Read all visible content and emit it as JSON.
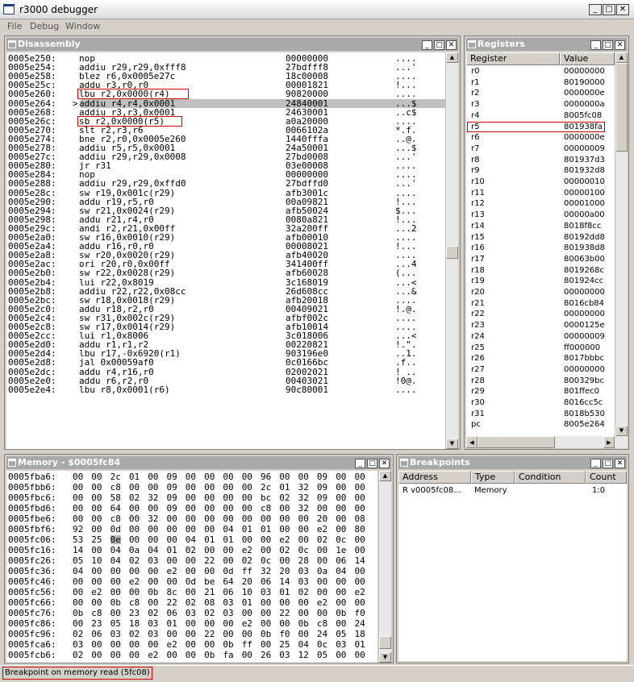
{
  "app": {
    "title": "r3000 debugger",
    "menus": [
      "File",
      "Debug",
      "Window"
    ]
  },
  "panels": {
    "disassembly": "Disassembly",
    "registers": "Registers",
    "memory": "Memory - $0005fc84",
    "breakpoints": "Breakpoints"
  },
  "disasm": [
    {
      "addr": "0005e250:",
      "cur": " ",
      "instr": "nop",
      "hex": "00000000",
      "ascii": "...."
    },
    {
      "addr": "0005e254:",
      "cur": " ",
      "instr": "addiu r29,r29,0xfff8",
      "hex": "27bdfff8",
      "ascii": "...'"
    },
    {
      "addr": "0005e258:",
      "cur": " ",
      "instr": "blez r6,0x0005e27c",
      "hex": "18c00008",
      "ascii": "...."
    },
    {
      "addr": "0005e25c:",
      "cur": " ",
      "instr": "addu r3,r0,r0",
      "hex": "00001821",
      "ascii": "!..."
    },
    {
      "addr": "0005e260:",
      "cur": " ",
      "instr": "lbu r2,0x0000(r4)",
      "hex": "90820000",
      "ascii": "...."
    },
    {
      "addr": "0005e264:",
      "cur": ">",
      "instr": "addiu r4,r4,0x0001",
      "hex": "24840001",
      "ascii": "...$"
    },
    {
      "addr": "0005e268:",
      "cur": " ",
      "instr": "addiu r3,r3,0x0001",
      "hex": "24630001",
      "ascii": "..c$"
    },
    {
      "addr": "0005e26c:",
      "cur": " ",
      "instr": "sb r2,0x0000(r5)",
      "hex": "a0a20000",
      "ascii": "...."
    },
    {
      "addr": "0005e270:",
      "cur": " ",
      "instr": "slt r2,r3,r6",
      "hex": "0066102a",
      "ascii": "*.f."
    },
    {
      "addr": "0005e274:",
      "cur": " ",
      "instr": "bne r2,r0,0x0005e260",
      "hex": "1440fffa",
      "ascii": "..@."
    },
    {
      "addr": "0005e278:",
      "cur": " ",
      "instr": "addiu r5,r5,0x0001",
      "hex": "24a50001",
      "ascii": "...$"
    },
    {
      "addr": "0005e27c:",
      "cur": " ",
      "instr": "addiu r29,r29,0x0008",
      "hex": "27bd0008",
      "ascii": "...'"
    },
    {
      "addr": "0005e280:",
      "cur": " ",
      "instr": "jr r31",
      "hex": "03e00008",
      "ascii": "...."
    },
    {
      "addr": "0005e284:",
      "cur": " ",
      "instr": "nop",
      "hex": "00000000",
      "ascii": "...."
    },
    {
      "addr": "0005e288:",
      "cur": " ",
      "instr": "addiu r29,r29,0xffd0",
      "hex": "27bdffd0",
      "ascii": "...'"
    },
    {
      "addr": "0005e28c:",
      "cur": " ",
      "instr": "sw r19,0x001c(r29)",
      "hex": "afb3001c",
      "ascii": "...."
    },
    {
      "addr": "0005e290:",
      "cur": " ",
      "instr": "addu r19,r5,r0",
      "hex": "00a09821",
      "ascii": "!..."
    },
    {
      "addr": "0005e294:",
      "cur": " ",
      "instr": "sw r21,0x0024(r29)",
      "hex": "afb50024",
      "ascii": "$..."
    },
    {
      "addr": "0005e298:",
      "cur": " ",
      "instr": "addu r21,r4,r0",
      "hex": "0080a821",
      "ascii": "!..."
    },
    {
      "addr": "0005e29c:",
      "cur": " ",
      "instr": "andi r2,r21,0x00ff",
      "hex": "32a200ff",
      "ascii": "...2"
    },
    {
      "addr": "0005e2a0:",
      "cur": " ",
      "instr": "sw r16,0x0010(r29)",
      "hex": "afb00010",
      "ascii": "...."
    },
    {
      "addr": "0005e2a4:",
      "cur": " ",
      "instr": "addu r16,r0,r0",
      "hex": "00008021",
      "ascii": "!..."
    },
    {
      "addr": "0005e2a8:",
      "cur": " ",
      "instr": "sw r20,0x0020(r29)",
      "hex": "afb40020",
      "ascii": "...."
    },
    {
      "addr": "0005e2ac:",
      "cur": " ",
      "instr": "ori r20,r0,0x00ff",
      "hex": "341400ff",
      "ascii": "...4"
    },
    {
      "addr": "0005e2b0:",
      "cur": " ",
      "instr": "sw r22,0x0028(r29)",
      "hex": "afb60028",
      "ascii": "(..."
    },
    {
      "addr": "0005e2b4:",
      "cur": " ",
      "instr": "lui r22,0x8019",
      "hex": "3c168019",
      "ascii": "...<"
    },
    {
      "addr": "0005e2b8:",
      "cur": " ",
      "instr": "addiu r22,r22,0x08cc",
      "hex": "26d608cc",
      "ascii": "...&"
    },
    {
      "addr": "0005e2bc:",
      "cur": " ",
      "instr": "sw r18,0x0018(r29)",
      "hex": "afb20018",
      "ascii": "...."
    },
    {
      "addr": "0005e2c0:",
      "cur": " ",
      "instr": "addu r18,r2,r0",
      "hex": "00409021",
      "ascii": "!.@."
    },
    {
      "addr": "0005e2c4:",
      "cur": " ",
      "instr": "sw r31,0x002c(r29)",
      "hex": "afbf002c",
      "ascii": "...."
    },
    {
      "addr": "0005e2c8:",
      "cur": " ",
      "instr": "sw r17,0x0014(r29)",
      "hex": "afb10014",
      "ascii": "...."
    },
    {
      "addr": "0005e2cc:",
      "cur": " ",
      "instr": "lui r1,0x8006",
      "hex": "3c018006",
      "ascii": "...<"
    },
    {
      "addr": "0005e2d0:",
      "cur": " ",
      "instr": "addu r1,r1,r2",
      "hex": "00220821",
      "ascii": "!.\"."
    },
    {
      "addr": "0005e2d4:",
      "cur": " ",
      "instr": "lbu r17,-0x6920(r1)",
      "hex": "903196e0",
      "ascii": "..1."
    },
    {
      "addr": "0005e2d8:",
      "cur": " ",
      "instr": "jal 0x00059af0",
      "hex": "0c0166bc",
      "ascii": ".f.."
    },
    {
      "addr": "0005e2dc:",
      "cur": " ",
      "instr": "addu r4,r16,r0",
      "hex": "02002021",
      "ascii": "! .."
    },
    {
      "addr": "0005e2e0:",
      "cur": " ",
      "instr": "addu r6,r2,r0",
      "hex": "00403021",
      "ascii": "!0@."
    },
    {
      "addr": "0005e2e4:",
      "cur": " ",
      "instr": "lbu r8,0x0001(r6)",
      "hex": "90c80001",
      "ascii": "...."
    }
  ],
  "registers": {
    "col_register": "Register",
    "col_value": "Value",
    "rows": [
      [
        "r0",
        "00000000"
      ],
      [
        "r1",
        "80190000"
      ],
      [
        "r2",
        "0000000e"
      ],
      [
        "r3",
        "0000000a"
      ],
      [
        "r4",
        "8005fc08"
      ],
      [
        "r5",
        "801938fa"
      ],
      [
        "r6",
        "0000000e"
      ],
      [
        "r7",
        "00000009"
      ],
      [
        "r8",
        "801937d3"
      ],
      [
        "r9",
        "801932d8"
      ],
      [
        "r10",
        "00000010"
      ],
      [
        "r11",
        "00000100"
      ],
      [
        "r12",
        "00001000"
      ],
      [
        "r13",
        "00000a00"
      ],
      [
        "r14",
        "8018f8cc"
      ],
      [
        "r15",
        "80192dd8"
      ],
      [
        "r16",
        "801938d8"
      ],
      [
        "r17",
        "80063b00"
      ],
      [
        "r18",
        "8019268c"
      ],
      [
        "r19",
        "801924cc"
      ],
      [
        "r20",
        "00000000"
      ],
      [
        "r21",
        "8016cb84"
      ],
      [
        "r22",
        "00000000"
      ],
      [
        "r23",
        "0000125e"
      ],
      [
        "r24",
        "00000009"
      ],
      [
        "r25",
        "ff000000"
      ],
      [
        "r26",
        "8017bbbc"
      ],
      [
        "r27",
        "00000000"
      ],
      [
        "r28",
        "800329bc"
      ],
      [
        "r29",
        "801ffec0"
      ],
      [
        "r30",
        "8016cc5c"
      ],
      [
        "r31",
        "8018b530"
      ],
      [
        "pc",
        "8005e264"
      ]
    ]
  },
  "memory": [
    {
      "addr": "0005fba6:",
      "bytes": [
        "00",
        "00",
        "2c",
        "01",
        "00",
        "09",
        "00",
        "00",
        "00",
        "00",
        "96",
        "00",
        "00",
        "09",
        "00",
        "00"
      ]
    },
    {
      "addr": "0005fbb6:",
      "bytes": [
        "00",
        "00",
        "c8",
        "00",
        "00",
        "09",
        "00",
        "00",
        "00",
        "00",
        "2c",
        "01",
        "32",
        "09",
        "00",
        "00"
      ]
    },
    {
      "addr": "0005fbc6:",
      "bytes": [
        "00",
        "00",
        "58",
        "02",
        "32",
        "09",
        "00",
        "00",
        "00",
        "00",
        "bc",
        "02",
        "32",
        "09",
        "00",
        "00"
      ]
    },
    {
      "addr": "0005fbd6:",
      "bytes": [
        "00",
        "00",
        "64",
        "00",
        "00",
        "09",
        "00",
        "00",
        "00",
        "00",
        "c8",
        "00",
        "32",
        "00",
        "00",
        "00"
      ]
    },
    {
      "addr": "0005fbe6:",
      "bytes": [
        "00",
        "00",
        "c8",
        "00",
        "32",
        "00",
        "00",
        "00",
        "00",
        "00",
        "00",
        "00",
        "00",
        "20",
        "00",
        "08"
      ]
    },
    {
      "addr": "0005fbf6:",
      "bytes": [
        "92",
        "00",
        "0d",
        "00",
        "00",
        "00",
        "00",
        "00",
        "04",
        "01",
        "01",
        "00",
        "00",
        "e2",
        "00",
        "80"
      ]
    },
    {
      "addr": "0005fc06:",
      "bytes": [
        "53",
        "25",
        "0e",
        "00",
        "00",
        "00",
        "04",
        "01",
        "01",
        "00",
        "00",
        "e2",
        "00",
        "02",
        "0c",
        "00"
      ]
    },
    {
      "addr": "0005fc16:",
      "bytes": [
        "14",
        "00",
        "04",
        "0a",
        "04",
        "01",
        "02",
        "00",
        "00",
        "e2",
        "00",
        "02",
        "0c",
        "00",
        "1e",
        "00"
      ]
    },
    {
      "addr": "0005fc26:",
      "bytes": [
        "05",
        "10",
        "04",
        "02",
        "03",
        "00",
        "00",
        "22",
        "00",
        "02",
        "0c",
        "00",
        "28",
        "00",
        "06",
        "14"
      ]
    },
    {
      "addr": "0005fc36:",
      "bytes": [
        "04",
        "00",
        "00",
        "00",
        "00",
        "e2",
        "00",
        "00",
        "0d",
        "ff",
        "32",
        "20",
        "03",
        "0a",
        "04",
        "00"
      ]
    },
    {
      "addr": "0005fc46:",
      "bytes": [
        "00",
        "00",
        "00",
        "e2",
        "00",
        "00",
        "0d",
        "be",
        "64",
        "20",
        "06",
        "14",
        "03",
        "00",
        "00",
        "00"
      ]
    },
    {
      "addr": "0005fc56:",
      "bytes": [
        "00",
        "e2",
        "00",
        "00",
        "0b",
        "8c",
        "00",
        "21",
        "06",
        "10",
        "03",
        "01",
        "02",
        "00",
        "00",
        "e2"
      ]
    },
    {
      "addr": "0005fc66:",
      "bytes": [
        "00",
        "00",
        "0b",
        "c8",
        "00",
        "22",
        "02",
        "08",
        "03",
        "01",
        "00",
        "00",
        "00",
        "e2",
        "00",
        "00"
      ]
    },
    {
      "addr": "0005fc76:",
      "bytes": [
        "0b",
        "c8",
        "00",
        "23",
        "02",
        "06",
        "03",
        "02",
        "03",
        "00",
        "00",
        "22",
        "00",
        "00",
        "0b",
        "f0"
      ]
    },
    {
      "addr": "0005fc86:",
      "bytes": [
        "00",
        "23",
        "05",
        "18",
        "03",
        "01",
        "00",
        "00",
        "00",
        "e2",
        "00",
        "00",
        "0b",
        "c8",
        "00",
        "24"
      ]
    },
    {
      "addr": "0005fc96:",
      "bytes": [
        "02",
        "06",
        "03",
        "02",
        "03",
        "00",
        "00",
        "22",
        "00",
        "00",
        "0b",
        "f0",
        "00",
        "24",
        "05",
        "18"
      ]
    },
    {
      "addr": "0005fca6:",
      "bytes": [
        "03",
        "00",
        "00",
        "00",
        "00",
        "e2",
        "00",
        "00",
        "0b",
        "ff",
        "00",
        "25",
        "04",
        "0c",
        "03",
        "01"
      ]
    },
    {
      "addr": "0005fcb6:",
      "bytes": [
        "02",
        "00",
        "00",
        "00",
        "e2",
        "00",
        "00",
        "0b",
        "fa",
        "00",
        "26",
        "03",
        "12",
        "05",
        "00",
        "00"
      ]
    }
  ],
  "breakpoints": {
    "col_address": "Address",
    "col_type": "Type",
    "col_condition": "Condition",
    "col_count": "Count",
    "rows": [
      {
        "address": "R  v0005fc08...",
        "type": "Memory",
        "condition": "",
        "count": "1:0"
      }
    ]
  },
  "status": "Breakpoint on memory read (5fc08)",
  "colors": {
    "highlight": "#d00000",
    "current_row": "#b8b8b8",
    "title_inactive": "#a8a8a8"
  }
}
